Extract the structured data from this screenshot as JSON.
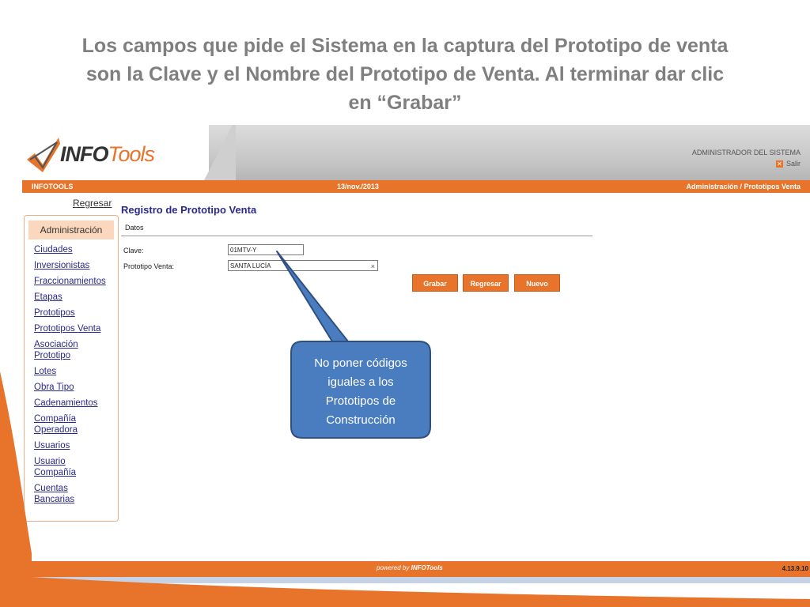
{
  "slide": {
    "title_lines": [
      "Los campos que pide el Sistema en la captura del Prototipo de venta",
      "son la Clave y el Nombre del Prototipo de Venta. Al terminar dar clic",
      "en “Grabar”"
    ]
  },
  "app": {
    "logo": {
      "part1": "INFO",
      "part2": "Tools"
    },
    "user_label": "ADMINISTRADOR DEL SISTEMA",
    "logout_label": "Salir",
    "bar": {
      "left": "INFOTOOLS",
      "date": "13/nov./2013",
      "breadcrumb": "Administración / Prototipos Venta"
    },
    "back_link": "Regresar",
    "sidebar": {
      "header": "Administración",
      "items": [
        "Ciudades",
        "Inversionistas",
        "Fraccionamientos",
        "Etapas",
        "Prototipos",
        "Prototipos Venta",
        "Asociación Prototipo",
        "Lotes",
        "Obra Tipo",
        "Cadenamientos",
        "Compañía Operadora",
        "Usuarios",
        "Usuario Compañía",
        "Cuentas Bancarias"
      ]
    },
    "form": {
      "title": "Registro de Prototipo Venta",
      "section": "Datos",
      "clave_label": "Clave:",
      "clave_value": "01MTV-Y",
      "nombre_label": "Prototipo Venta:",
      "nombre_value": "SANTA LUCÍA",
      "buttons": {
        "save": "Grabar",
        "back": "Regresar",
        "new": "Nuevo"
      }
    },
    "footer": {
      "powered": "powered by",
      "brand": "INFOTools",
      "version": "4.13.9.10"
    }
  },
  "callout": {
    "lines": [
      "No poner códigos",
      "iguales a los",
      "Prototipos  de",
      "Construcción"
    ]
  },
  "colors": {
    "accent": "#e8742b",
    "callout_fill": "#4a7cc0",
    "callout_border": "#2f4f80",
    "title": "#7f7f7f"
  }
}
